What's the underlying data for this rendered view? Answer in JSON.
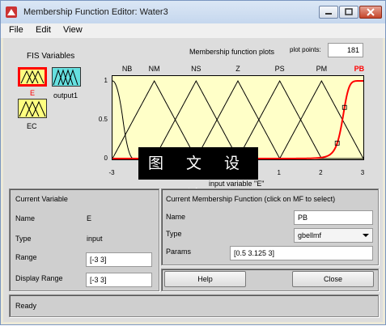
{
  "window": {
    "title": "Membership Function Editor: Water3",
    "menu": [
      "File",
      "Edit",
      "View"
    ]
  },
  "fis": {
    "heading": "FIS Variables",
    "inputs": [
      "E",
      "EC"
    ],
    "outputs": [
      "output1"
    ],
    "selected": "E"
  },
  "plot": {
    "title": "Membership function plots",
    "points_label": "plot points:",
    "points_value": "181",
    "xlabel": "input variable \"E\"",
    "overlay_text": "图 文 设 计"
  },
  "chart_data": {
    "type": "line",
    "title": "Membership function plots",
    "xlabel": "input variable \"E\"",
    "xlim": [
      -3,
      3
    ],
    "ylim": [
      0,
      1
    ],
    "xticks": [
      "-3",
      "-2",
      "-1",
      "0",
      "1",
      "2",
      "3"
    ],
    "yticks": [
      "0",
      "0.5",
      "1"
    ],
    "selected_mf": "PB",
    "series": [
      {
        "name": "NB",
        "shape": "zmf",
        "params": [
          -3,
          -2.5
        ]
      },
      {
        "name": "NM",
        "shape": "trimf",
        "params": [
          -3,
          -2,
          -1
        ]
      },
      {
        "name": "NS",
        "shape": "trimf",
        "params": [
          -2,
          -1,
          0
        ]
      },
      {
        "name": "Z",
        "shape": "trimf",
        "params": [
          -1,
          0,
          1
        ]
      },
      {
        "name": "PS",
        "shape": "trimf",
        "params": [
          0,
          1,
          2
        ]
      },
      {
        "name": "PM",
        "shape": "trimf",
        "params": [
          1,
          2,
          3
        ]
      },
      {
        "name": "PB",
        "shape": "gbellmf",
        "params": [
          0.5,
          3.125,
          3
        ]
      }
    ]
  },
  "current_variable": {
    "heading": "Current Variable",
    "name_label": "Name",
    "name_value": "E",
    "type_label": "Type",
    "type_value": "input",
    "range_label": "Range",
    "range_value": "[-3 3]",
    "display_range_label": "Display Range",
    "display_range_value": "[-3 3]"
  },
  "current_mf": {
    "heading": "Current Membership Function (click on MF to select)",
    "name_label": "Name",
    "name_value": "PB",
    "type_label": "Type",
    "type_value": "gbellmf",
    "params_label": "Params",
    "params_value": "[0.5 3.125 3]"
  },
  "buttons": {
    "help": "Help",
    "close": "Close"
  },
  "status": "Ready",
  "colors": {
    "accent_selected": "#ff0000",
    "input_fill": "#ffff80",
    "output_fill": "#66e0e0",
    "plot_bg": "#ffffc8"
  }
}
